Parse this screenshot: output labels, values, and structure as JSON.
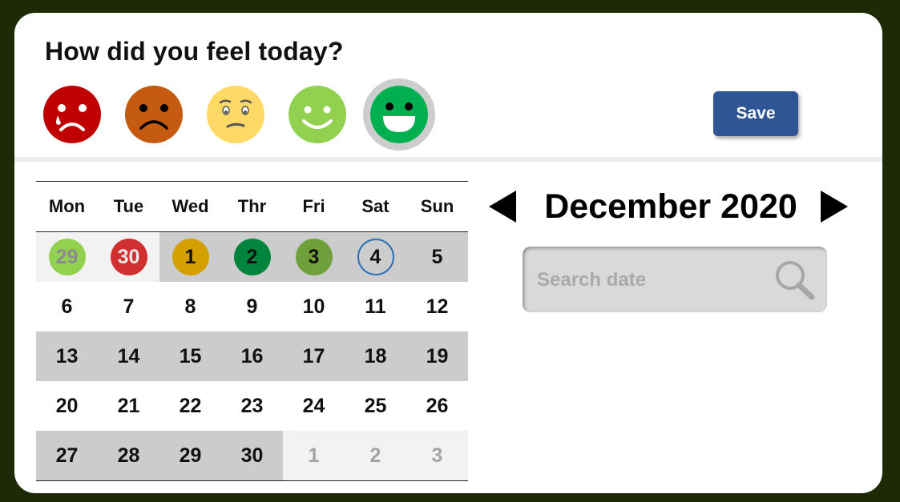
{
  "question": "How did you feel today?",
  "moods": [
    {
      "name": "very-sad",
      "color": "#c00000"
    },
    {
      "name": "sad",
      "color": "#c55a11"
    },
    {
      "name": "meh",
      "color": "#ffd966"
    },
    {
      "name": "happy",
      "color": "#92d050"
    },
    {
      "name": "very-happy",
      "color": "#00b050",
      "selected": true
    }
  ],
  "save_label": "Save",
  "calendar": {
    "month_title": "December 2020",
    "weekdays": [
      "Mon",
      "Tue",
      "Wed",
      "Thr",
      "Fri",
      "Sat",
      "Sun"
    ],
    "weeks": [
      [
        "29",
        "30",
        "1",
        "2",
        "3",
        "4",
        "5"
      ],
      [
        "6",
        "7",
        "8",
        "9",
        "10",
        "11",
        "12"
      ],
      [
        "13",
        "14",
        "15",
        "16",
        "17",
        "18",
        "19"
      ],
      [
        "20",
        "21",
        "22",
        "23",
        "24",
        "25",
        "26"
      ],
      [
        "27",
        "28",
        "29",
        "30",
        "1",
        "2",
        "3"
      ]
    ],
    "mood_markers": [
      {
        "day": "29",
        "color": "#92d050"
      },
      {
        "day": "30",
        "color": "#d03030"
      },
      {
        "day": "1",
        "color": "#d4a000"
      },
      {
        "day": "2",
        "color": "#00843d"
      },
      {
        "day": "3",
        "color": "#70a03c"
      }
    ],
    "today": "4"
  },
  "search": {
    "placeholder": "Search date"
  }
}
